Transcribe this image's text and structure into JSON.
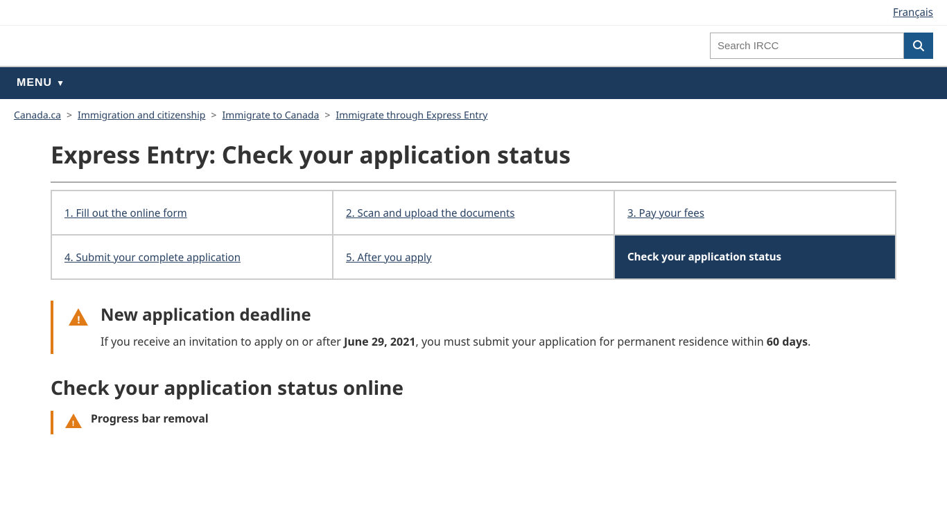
{
  "topbar": {
    "lang_link": "Français"
  },
  "search": {
    "placeholder": "Search IRCC",
    "button_icon": "🔍"
  },
  "menu": {
    "label": "MENU"
  },
  "breadcrumb": {
    "items": [
      {
        "label": "Canada.ca",
        "href": "#"
      },
      {
        "label": "Immigration and citizenship",
        "href": "#"
      },
      {
        "label": "Immigrate to Canada",
        "href": "#"
      },
      {
        "label": "Immigrate through Express Entry",
        "href": "#"
      }
    ]
  },
  "page": {
    "title": "Express Entry: Check your application status",
    "steps": [
      {
        "label": "1. Fill out the online form",
        "active": false
      },
      {
        "label": "2. Scan and upload the documents",
        "active": false
      },
      {
        "label": "3. Pay your fees",
        "active": false
      },
      {
        "label": "4. Submit your complete application",
        "active": false
      },
      {
        "label": "5. After you apply",
        "active": false
      },
      {
        "label": "Check your application status",
        "active": true
      }
    ],
    "alert": {
      "title": "New application deadline",
      "text_before": "If you receive an invitation to apply on or after ",
      "bold_date": "June 29, 2021",
      "text_middle": ", you must submit your application for permanent residence within ",
      "bold_days": "60 days",
      "text_after": "."
    },
    "section_title": "Check your application status online",
    "sub_alert_label": "Progress bar removal"
  }
}
